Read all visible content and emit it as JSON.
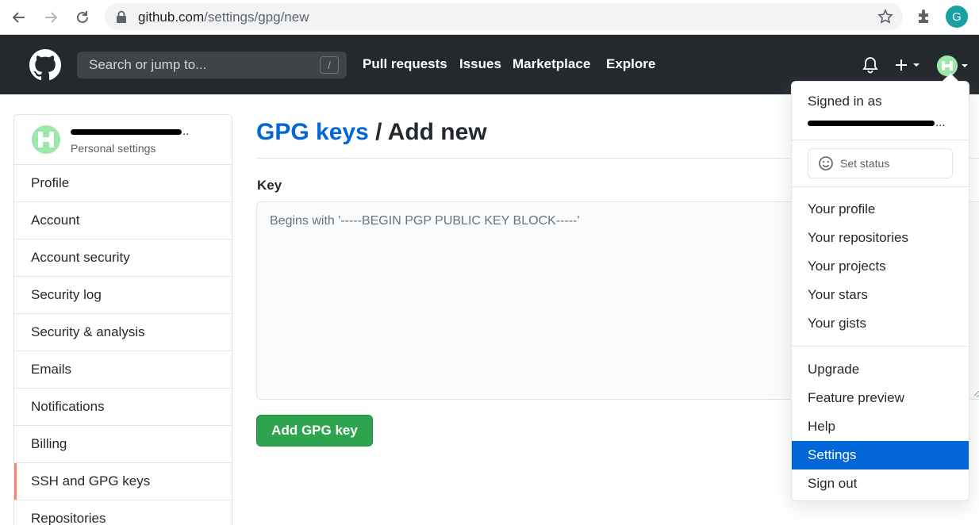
{
  "browser": {
    "url_host": "github.com",
    "url_path": "/settings/gpg/new",
    "profile_initial": "G"
  },
  "header": {
    "search_placeholder": "Search or jump to...",
    "search_shortcut": "/",
    "nav": [
      "Pull requests",
      "Issues",
      "Marketplace",
      "Explore"
    ]
  },
  "sidebar": {
    "username_suffix": "..",
    "subtitle": "Personal settings",
    "items": [
      {
        "label": "Profile"
      },
      {
        "label": "Account"
      },
      {
        "label": "Account security"
      },
      {
        "label": "Security log"
      },
      {
        "label": "Security & analysis"
      },
      {
        "label": "Emails"
      },
      {
        "label": "Notifications"
      },
      {
        "label": "Billing"
      },
      {
        "label": "SSH and GPG keys",
        "active": true
      },
      {
        "label": "Repositories"
      }
    ]
  },
  "main": {
    "title_link": "GPG keys",
    "title_rest": " / Add new",
    "key_label": "Key",
    "key_placeholder": "Begins with '-----BEGIN PGP PUBLIC KEY BLOCK-----'",
    "submit_label": "Add GPG key"
  },
  "dropdown": {
    "signed_in_as": "Signed in as",
    "username_suffix": "...",
    "set_status": "Set status",
    "group1": [
      "Your profile",
      "Your repositories",
      "Your projects",
      "Your stars",
      "Your gists"
    ],
    "group2": [
      "Upgrade",
      "Feature preview",
      "Help",
      "Settings",
      "Sign out"
    ],
    "selected": "Settings"
  },
  "colors": {
    "header_bg": "#24292e",
    "link_blue": "#0366d6",
    "primary_green": "#2ea44f",
    "active_accent": "#f9826c"
  }
}
